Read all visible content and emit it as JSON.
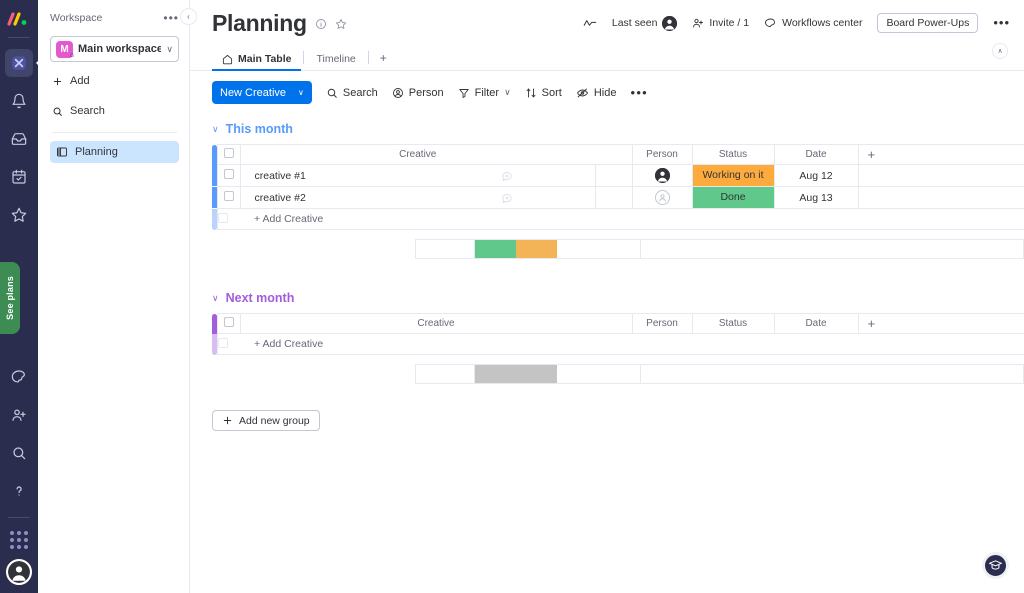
{
  "rail": {
    "logo_icon": "monday-logo-icon",
    "items": [
      {
        "icon": "workspace-icon",
        "name": "workspace",
        "active": true
      },
      {
        "icon": "bell-icon",
        "name": "notifications",
        "active": false
      },
      {
        "icon": "inbox-icon",
        "name": "inbox",
        "active": false
      },
      {
        "icon": "my-work-icon",
        "name": "my-work",
        "active": false
      },
      {
        "icon": "star-icon",
        "name": "favorites",
        "active": false
      }
    ],
    "see_plans_label": "See plans",
    "bottom_items": [
      {
        "icon": "apps-marketplace-icon",
        "name": "marketplace"
      },
      {
        "icon": "invite-member-icon",
        "name": "invite-members"
      },
      {
        "icon": "search-icon",
        "name": "search"
      },
      {
        "icon": "help-question-icon",
        "name": "help"
      }
    ],
    "apps_grid_icon": "apps-grid-icon",
    "avatar_icon": "user-avatar-icon"
  },
  "workspace": {
    "header_label": "Workspace",
    "dots_label": "•••",
    "selected": {
      "initial": "M",
      "name": "Main workspace",
      "chevron": "∨"
    },
    "add_label": "Add",
    "search_label": "Search",
    "boards": [
      {
        "label": "Planning",
        "icon": "board-icon",
        "selected": true
      }
    ],
    "collapse_chevron": "‹"
  },
  "header": {
    "board_title": "Planning",
    "info_icon": "info-circle-icon",
    "star_icon": "star-outline-icon",
    "activity_icon": "activity-graph-icon",
    "last_seen_label": "Last seen",
    "invite_label": "Invite / 1",
    "workflows_label": "Workflows center",
    "power_ups_label": "Board Power-Ups",
    "more_label": "•••",
    "collapse_up_chevron": "∧"
  },
  "tabs": [
    {
      "label": "Main Table",
      "icon": "home-icon",
      "active": true
    },
    {
      "label": "Timeline",
      "icon": "",
      "active": false
    }
  ],
  "tab_add_label": "+",
  "toolbar": {
    "new_item_label": "New Creative",
    "new_item_chevron": "∨",
    "search_label": "Search",
    "person_label": "Person",
    "filter_label": "Filter",
    "filter_chevron": "∨",
    "sort_label": "Sort",
    "hide_label": "Hide",
    "more_label": "•••"
  },
  "table": {
    "columns": [
      "Creative",
      "Person",
      "Status",
      "Date"
    ],
    "add_column_icon": "plus-icon",
    "add_item_label": "+ Add Creative"
  },
  "groups": [
    {
      "name": "This month",
      "color": "#579bfc",
      "chevron": "∨",
      "rows": [
        {
          "name": "creative #1",
          "person": "filled",
          "status": {
            "label": "Working on it",
            "color": "#fdab3d"
          },
          "date": "Aug 12",
          "comment_icon": "add-comment-icon"
        },
        {
          "name": "creative #2",
          "person": "empty",
          "status": {
            "label": "Done",
            "color": "#5fc88a"
          },
          "date": "Aug 13",
          "comment_icon": "add-comment-icon"
        }
      ],
      "summary": [
        {
          "color": "#5fc88a",
          "pct": 50
        },
        {
          "color": "#f2b456",
          "pct": 50
        }
      ]
    },
    {
      "name": "Next month",
      "color": "#a25ddc",
      "chevron": "∨",
      "rows": [],
      "summary": [
        {
          "color": "#c4c4c4",
          "pct": 100
        }
      ]
    }
  ],
  "add_group_label": "Add new group",
  "help_fab_icon": "graduation-cap-icon"
}
